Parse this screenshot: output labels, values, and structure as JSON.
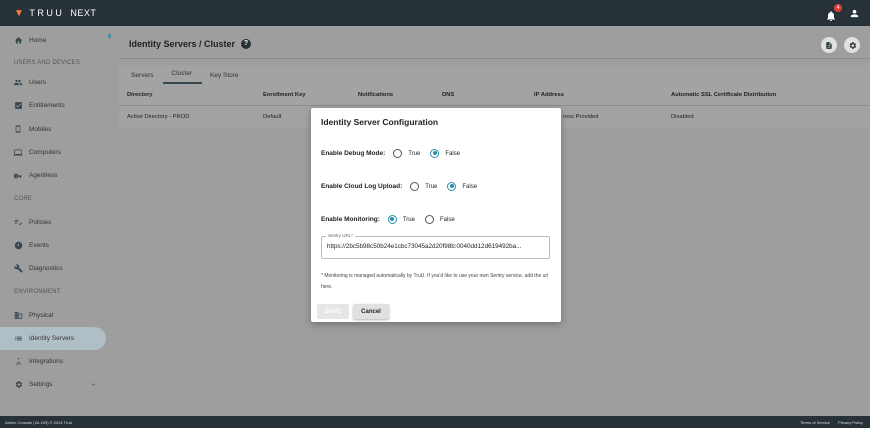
{
  "brand": {
    "logo_text": "TRUU",
    "product": "NEXT",
    "accent": "#ff7a3d"
  },
  "topbar": {
    "notification_count": "4"
  },
  "sidebar": {
    "items": [
      {
        "label": "Home",
        "icon": "home-icon"
      },
      {
        "section": "USERS AND DEVICES"
      },
      {
        "label": "Users",
        "icon": "users-icon"
      },
      {
        "label": "Entitlements",
        "icon": "checkbox-icon"
      },
      {
        "label": "Mobiles",
        "icon": "mobile-icon"
      },
      {
        "label": "Computers",
        "icon": "laptop-icon"
      },
      {
        "label": "Agentless",
        "icon": "key-icon"
      },
      {
        "section": "CORE"
      },
      {
        "label": "Policies",
        "icon": "policy-icon"
      },
      {
        "label": "Events",
        "icon": "clock-icon"
      },
      {
        "label": "Diagnostics",
        "icon": "wrench-icon"
      },
      {
        "section": "ENVIRONMENT"
      },
      {
        "label": "Physical",
        "icon": "building-icon"
      },
      {
        "label": "Identity Servers",
        "icon": "list-icon",
        "active": true
      },
      {
        "label": "Integrations",
        "icon": "integration-icon"
      },
      {
        "label": "Settings",
        "icon": "gear-icon"
      }
    ]
  },
  "header": {
    "title": "Identity Servers / Cluster"
  },
  "tabs": [
    "Servers",
    "Cluster",
    "Key Store"
  ],
  "active_tab": "Cluster",
  "table": {
    "columns": [
      "Directory",
      "Enrollment Key",
      "Notifications",
      "DNS",
      "IP Address",
      "Automatic SSL Certificate Distribution"
    ],
    "rows": [
      [
        "Active Directory - PROD",
        "Default",
        "",
        "",
        "ress Provided",
        "Disabled"
      ]
    ]
  },
  "modal": {
    "title": "Identity Server Configuration",
    "debug_label": "Enable Debug Mode:",
    "cloud_log_label": "Enable Cloud Log Upload:",
    "monitoring_label": "Enable Monitoring:",
    "true_label": "True",
    "false_label": "False",
    "debug_value": "False",
    "cloud_log_value": "False",
    "monitoring_value": "True",
    "sentry_label": "Sentry URL*",
    "sentry_value": "https://2bc5b98c50b24e1cbc73045a2d20f98b:0040dd12d619492ba...",
    "note": "* Monitoring is managed automatically by TruU. If you'd like to use your own Sentry service, add the url here.",
    "save_label": "SAVE",
    "cancel_label": "Cancel"
  },
  "footer": {
    "left": "Admin Console (2A.193) © 2024 TruU",
    "terms": "Terms of Service",
    "privacy": "Privacy Policy"
  }
}
